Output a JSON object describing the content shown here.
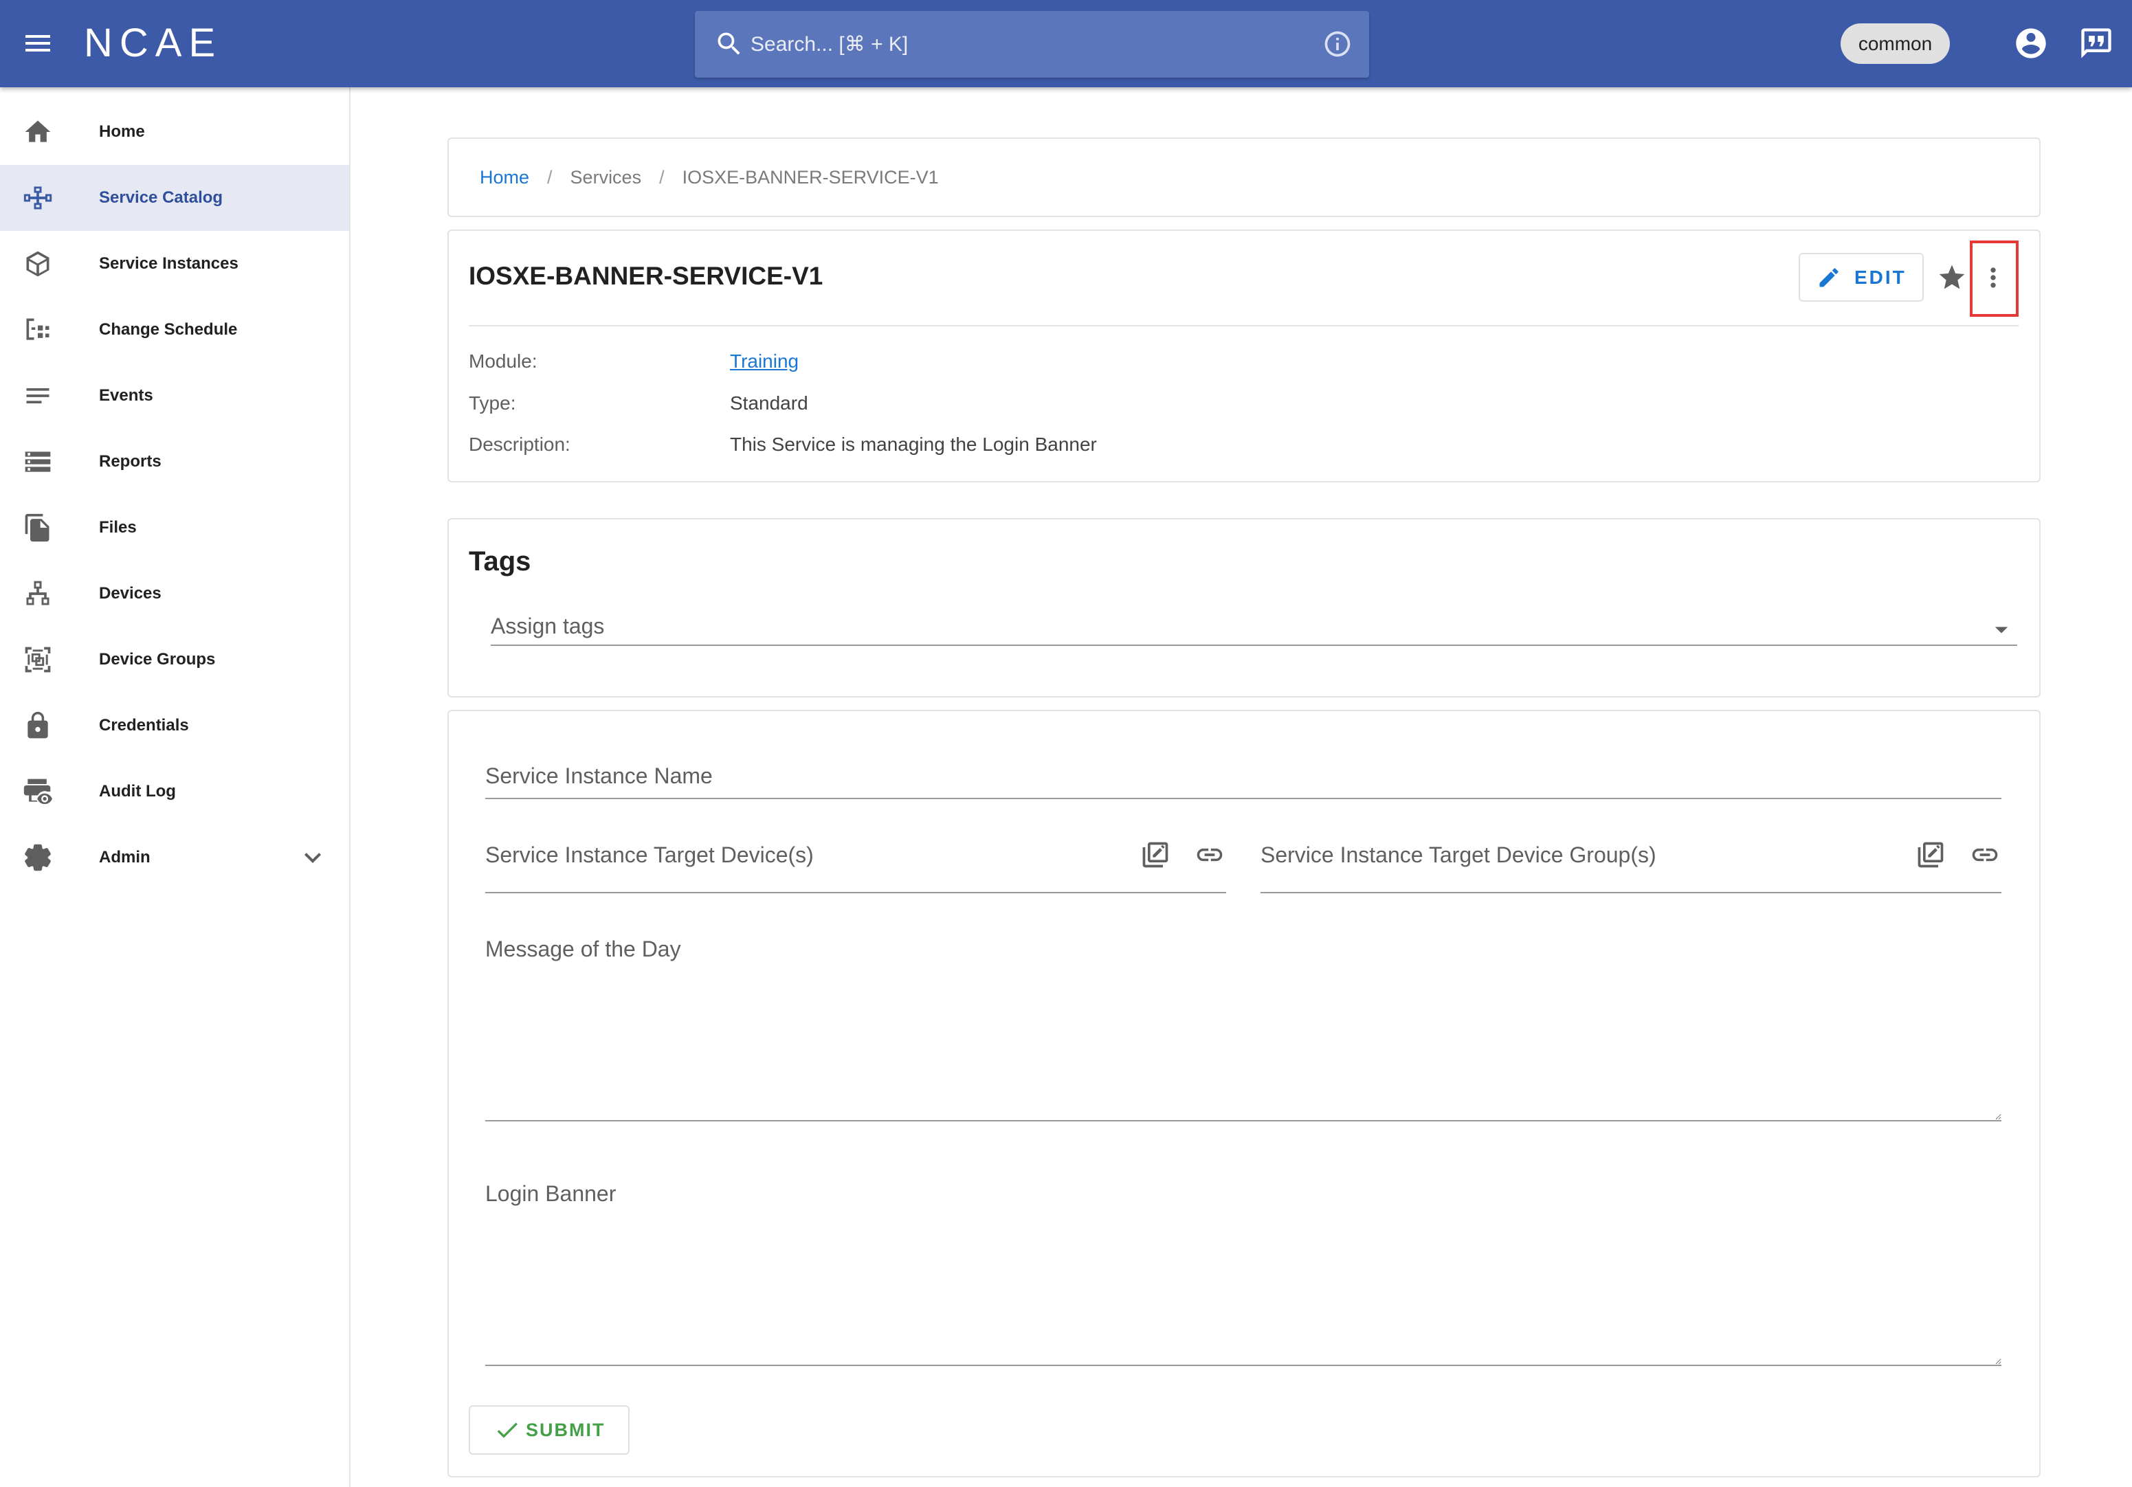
{
  "colors": {
    "header_bg": "#3d5aa8",
    "search_bg": "#5b76bb",
    "nav_selected_bg": "#e6e9f4",
    "nav_selected_text": "#2f4f9c",
    "link": "#1976d2",
    "submit": "#43a047",
    "highlight_box": "#e53935"
  },
  "header": {
    "menu_icon": "menu-icon",
    "logo": "NCAE",
    "search": {
      "icon": "search-icon",
      "placeholder": "Search... [⌘ + K]",
      "info_icon": "info-icon"
    },
    "workspace_chip": "common",
    "account_icon": "account-circle-icon",
    "feedback_icon": "feedback-icon"
  },
  "sidebar": {
    "items": [
      {
        "label": "Home",
        "icon": "home-icon"
      },
      {
        "label": "Service Catalog",
        "icon": "service-catalog-icon",
        "active": true
      },
      {
        "label": "Service Instances",
        "icon": "cube-icon"
      },
      {
        "label": "Change Schedule",
        "icon": "schedule-tree-icon"
      },
      {
        "label": "Events",
        "icon": "events-list-icon"
      },
      {
        "label": "Reports",
        "icon": "reports-icon"
      },
      {
        "label": "Files",
        "icon": "files-icon"
      },
      {
        "label": "Devices",
        "icon": "network-devices-icon"
      },
      {
        "label": "Device Groups",
        "icon": "device-groups-icon"
      },
      {
        "label": "Credentials",
        "icon": "lock-icon"
      },
      {
        "label": "Audit Log",
        "icon": "audit-log-icon"
      },
      {
        "label": "Admin",
        "icon": "gear-icon",
        "expand_icon": "chevron-down-icon"
      }
    ]
  },
  "breadcrumb": {
    "separator": "/",
    "items": [
      "Home",
      "Services",
      "IOSXE-BANNER-SERVICE-V1"
    ]
  },
  "service": {
    "title": "IOSXE-BANNER-SERVICE-V1",
    "edit_label": "EDIT",
    "edit_icon": "pencil-icon",
    "favorite_icon": "star-icon",
    "more_icon": "more-vert-icon",
    "fields": [
      {
        "label": "Module:",
        "value": "Training"
      },
      {
        "label": "Type:",
        "value": "Standard"
      },
      {
        "label": "Description:",
        "value": "This Service is managing the Login Banner"
      }
    ]
  },
  "tags": {
    "title": "Tags",
    "placeholder": "Assign tags"
  },
  "form": {
    "instance_name": {
      "label": "Service Instance Name"
    },
    "target_devices": {
      "label": "Service Instance Target Device(s)",
      "picker_icon": "select-list-icon",
      "link_icon": "link-icon"
    },
    "target_device_groups": {
      "label": "Service Instance Target Device Group(s)",
      "picker_icon": "select-list-icon",
      "link_icon": "link-icon"
    },
    "message_of_the_day": {
      "label": "Message of the Day"
    },
    "login_banner": {
      "label": "Login Banner"
    },
    "submit_label": "SUBMIT"
  }
}
